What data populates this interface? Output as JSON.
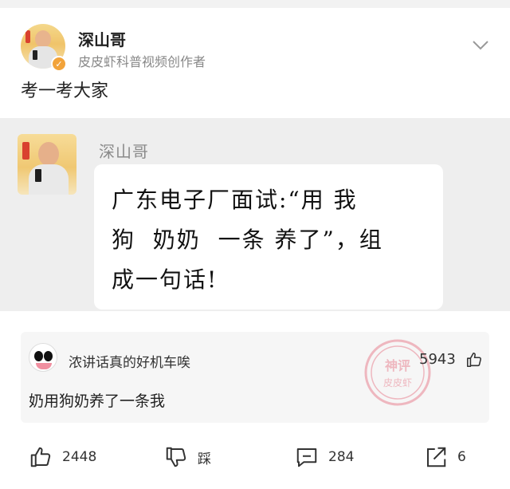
{
  "author": {
    "name": "深山哥",
    "title": "皮皮虾科普视频创作者",
    "verified_mark": "✓"
  },
  "post": {
    "text": "考一考大家"
  },
  "embed": {
    "name": "深山哥",
    "message": "广东电子厂面试:“用 我\n狗  奶奶  一条 养了”，组\n成一句话!"
  },
  "comment": {
    "user": "浓讲话真的好机车唉",
    "likes": "5943",
    "text": "奶用狗奶养了一条我",
    "stamp_lines": [
      "神评",
      "皮皮虾"
    ]
  },
  "actions": {
    "like_count": "2448",
    "dislike_label": "踩",
    "comment_count": "284",
    "share_count": "6"
  },
  "colors": {
    "badge": "#f2a33a",
    "stamp": "#e0435a"
  }
}
